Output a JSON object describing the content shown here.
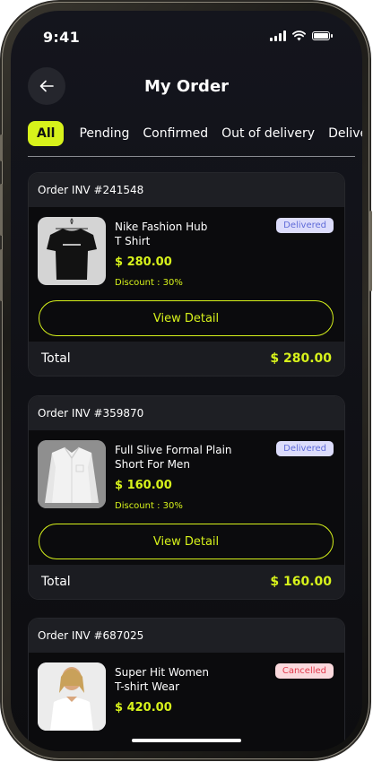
{
  "status_bar": {
    "time": "9:41"
  },
  "header": {
    "title": "My Order"
  },
  "tabs": [
    {
      "label": "All",
      "active": true
    },
    {
      "label": "Pending",
      "active": false
    },
    {
      "label": "Confirmed",
      "active": false
    },
    {
      "label": "Out of delivery",
      "active": false
    },
    {
      "label": "Deliver",
      "active": false
    }
  ],
  "orders": [
    {
      "invoice": "Order INV #241548",
      "product_line1": "Nike Fashion Hub",
      "product_line2": "T Shirt",
      "price": "$ 280.00",
      "discount": "Discount : 30%",
      "status": "Delivered",
      "button": "View Detail",
      "total_label": "Total",
      "total": "$ 280.00",
      "image": "black-t-shirt-on-hanger"
    },
    {
      "invoice": "Order INV #359870",
      "product_line1": "Full Slive Formal Plain",
      "product_line2": "Short For Men",
      "price": "$ 160.00",
      "discount": "Discount : 30%",
      "status": "Delivered",
      "button": "View Detail",
      "total_label": "Total",
      "total": "$ 160.00",
      "image": "white-formal-shirt"
    },
    {
      "invoice": "Order INV #687025",
      "product_line1": "Super Hit Women",
      "product_line2": "T-shirt Wear",
      "price": "$ 420.00",
      "status": "Cancelled",
      "image": "woman-in-white-t-shirt"
    }
  ],
  "colors": {
    "accent": "#d7f21b",
    "background": "#0d0d10",
    "card_header": "#1e1f24"
  }
}
